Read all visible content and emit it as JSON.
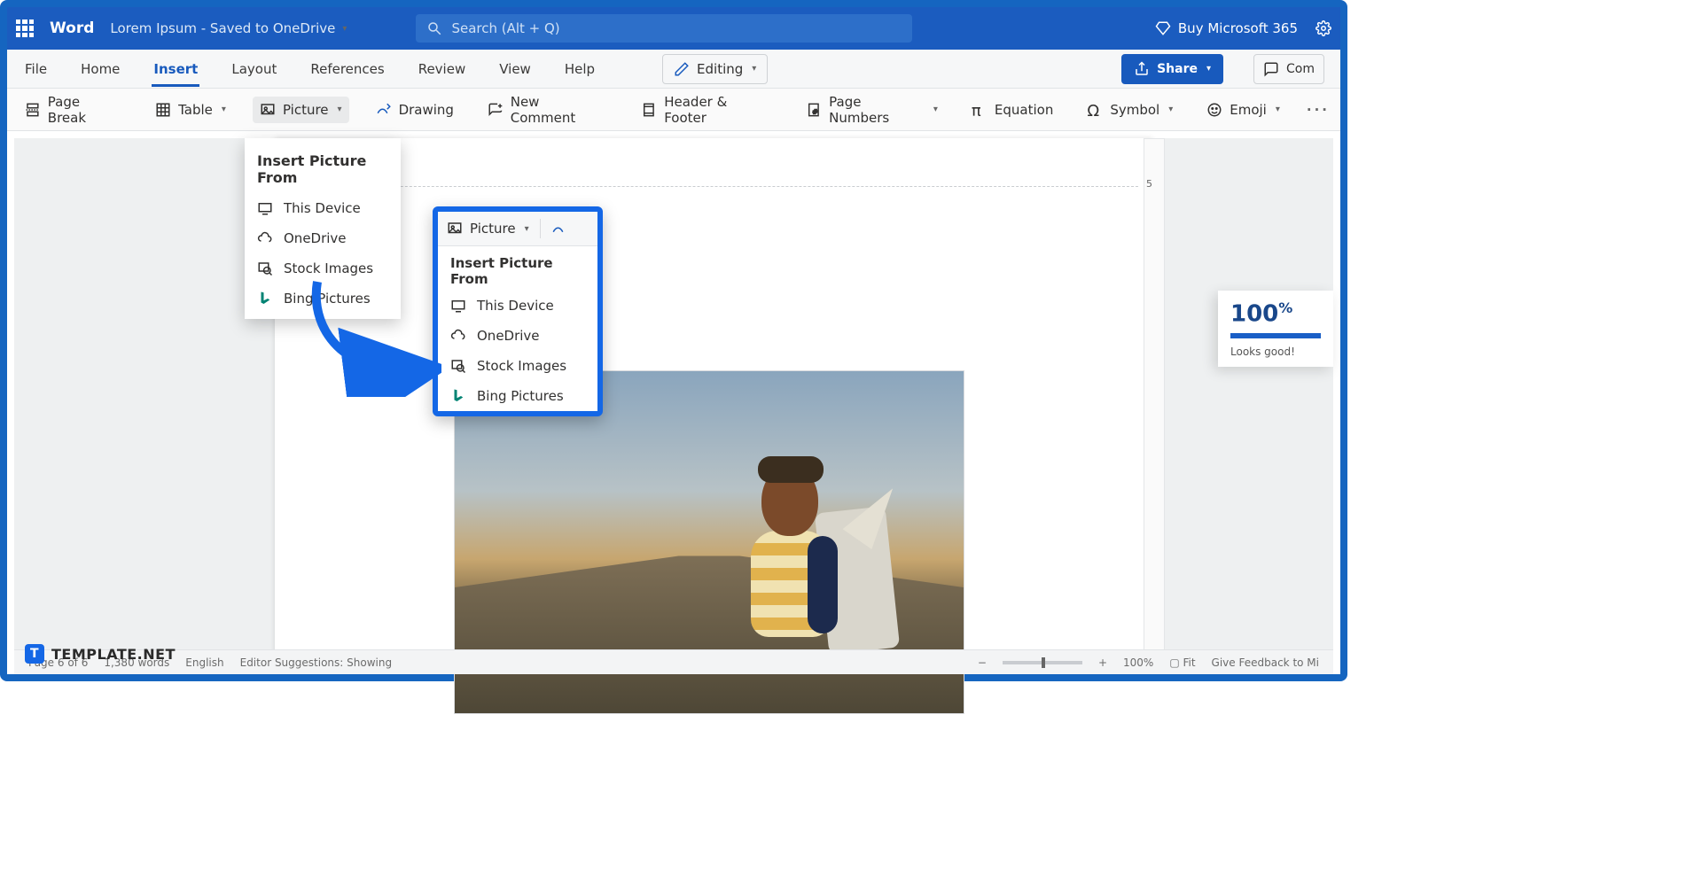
{
  "titlebar": {
    "app": "Word",
    "doc": "Lorem Ipsum  -  Saved to OneDrive",
    "search_placeholder": "Search (Alt + Q)",
    "buy": "Buy Microsoft 365"
  },
  "tabs": [
    "File",
    "Home",
    "Insert",
    "Layout",
    "References",
    "Review",
    "View",
    "Help"
  ],
  "active_tab": "Insert",
  "editing_label": "Editing",
  "share_label": "Share",
  "comments_label": "Com",
  "ribbon": [
    {
      "key": "pagebreak",
      "label": "Page Break"
    },
    {
      "key": "table",
      "label": "Table",
      "dropdown": true
    },
    {
      "key": "picture",
      "label": "Picture",
      "dropdown": true,
      "selected": true
    },
    {
      "key": "drawing",
      "label": "Drawing"
    },
    {
      "key": "newcomment",
      "label": "New Comment"
    },
    {
      "key": "headerfooter",
      "label": "Header & Footer"
    },
    {
      "key": "pagenumbers",
      "label": "Page Numbers",
      "dropdown": true
    },
    {
      "key": "equation",
      "label": "Equation"
    },
    {
      "key": "symbol",
      "label": "Symbol",
      "dropdown": true
    },
    {
      "key": "emoji",
      "label": "Emoji",
      "dropdown": true
    }
  ],
  "picture_menu": {
    "header": "Insert Picture From",
    "items": [
      {
        "key": "device",
        "label": "This Device"
      },
      {
        "key": "onedrive",
        "label": "OneDrive"
      },
      {
        "key": "stock",
        "label": "Stock Images"
      },
      {
        "key": "bing",
        "label": "Bing Pictures"
      }
    ]
  },
  "callout_menu": {
    "button_label": "Picture",
    "header": "Insert Picture From",
    "items": [
      {
        "key": "device",
        "label": "This Device"
      },
      {
        "key": "onedrive",
        "label": "OneDrive"
      },
      {
        "key": "stock",
        "label": "Stock Images"
      },
      {
        "key": "bing",
        "label": "Bing Pictures"
      }
    ]
  },
  "ruler_tick": "5",
  "editor_score": {
    "percent": "100",
    "suffix": "%",
    "message": "Looks good!"
  },
  "status": {
    "page": "Page 6 of 6",
    "words": "1,380 words",
    "lang": "English",
    "suggestions": "Editor Suggestions: Showing",
    "zoom": "100%",
    "fit": "Fit",
    "feedback": "Give Feedback to Mi"
  },
  "watermark": "TEMPLATE.NET"
}
